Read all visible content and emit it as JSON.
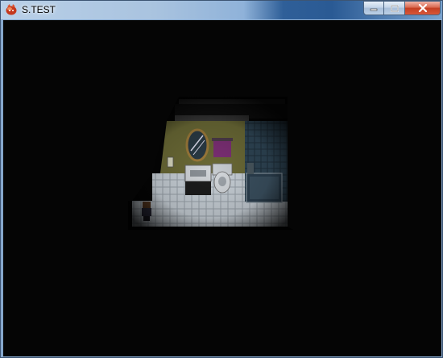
{
  "window": {
    "title": "S.TEST",
    "icon": "app-icon",
    "controls": [
      "minimize-icon",
      "maximize-icon",
      "close-icon"
    ]
  },
  "scene": {
    "description_colors": {
      "background": "#050505",
      "tile": "#c8cfd6",
      "wall": "#6e6a33",
      "curtain": "#7b2f74",
      "mirror_frame": "#a08040"
    }
  }
}
